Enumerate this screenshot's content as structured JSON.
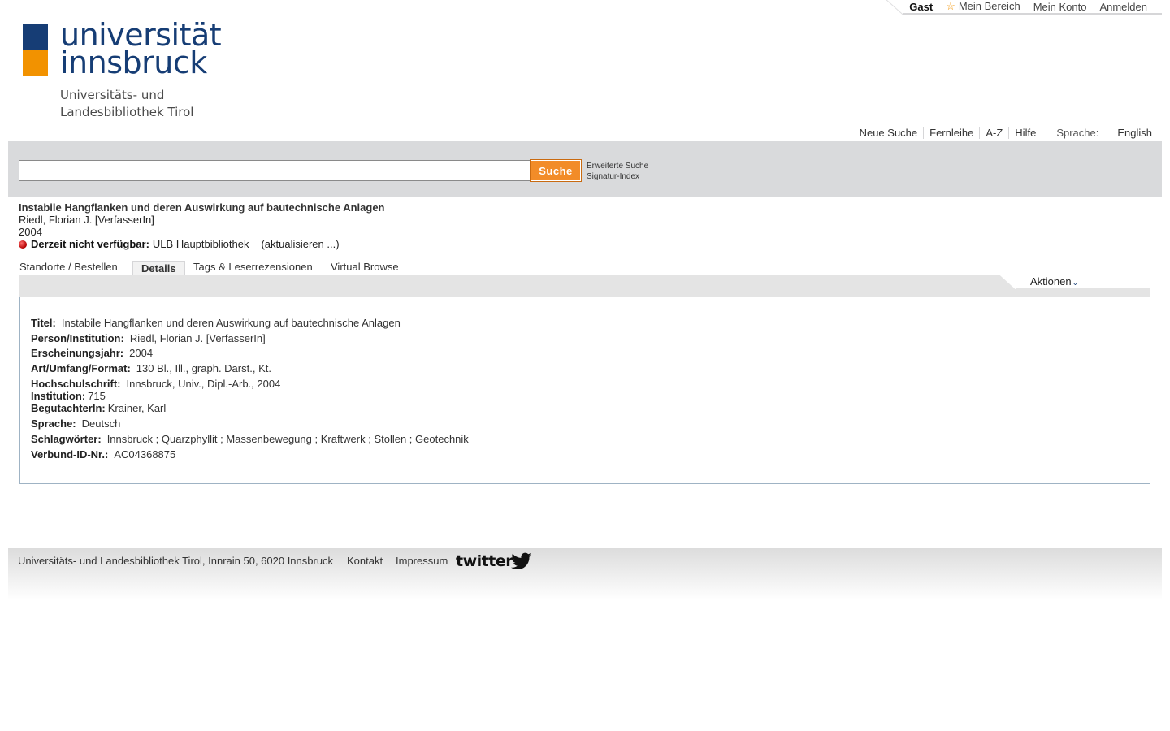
{
  "userbar": {
    "guest": "Gast",
    "my_area": "Mein Bereich",
    "my_account": "Mein Konto",
    "login": "Anmelden"
  },
  "logo": {
    "line1": "universität",
    "line2": "innsbruck",
    "sub1": "Universitäts- und",
    "sub2": "Landesbibliothek Tirol"
  },
  "topnav": {
    "items": [
      "Neue Suche",
      "Fernleihe",
      "A-Z",
      "Hilfe"
    ],
    "language_label": "Sprache:",
    "language": "English"
  },
  "search": {
    "value": "",
    "button": "Suche",
    "advanced": "Erweiterte Suche",
    "signature_index": "Signatur-Index"
  },
  "record": {
    "title": "Instabile Hangflanken und deren Auswirkung auf bautechnische Anlagen",
    "author": "Riedl, Florian J. [VerfasserIn]",
    "year": "2004",
    "availability_label": "Derzeit nicht verfügbar:",
    "availability_location": "ULB Hauptbibliothek",
    "refresh": "(aktualisieren ...)"
  },
  "tabs": [
    "Standorte / Bestellen",
    "Details",
    "Tags & Leserrezensionen",
    "Virtual Browse"
  ],
  "actions_label": "Aktionen",
  "details": [
    {
      "key": "Titel:",
      "value": "Instabile Hangflanken und deren Auswirkung auf bautechnische Anlagen"
    },
    {
      "key": "Person/Institution:",
      "value": "Riedl, Florian J. [VerfasserIn]"
    },
    {
      "key": "Erscheinungsjahr:",
      "value": "2004"
    },
    {
      "key": "Art/Umfang/Format:",
      "value": "130 Bl., Ill., graph. Darst., Kt."
    },
    {
      "key": "Hochschulschrift:",
      "value": "Innsbruck, Univ., Dipl.-Arb., 2004"
    },
    {
      "key": "Institution:",
      "value": "715"
    },
    {
      "key": "BegutachterIn:",
      "value": "Krainer, Karl"
    },
    {
      "key": "Sprache:",
      "value": "Deutsch"
    },
    {
      "key": "Schlagwörter:",
      "value": "Innsbruck ; Quarzphyllit ; Massenbewegung ; Kraftwerk ; Stollen ; Geotechnik"
    },
    {
      "key": "Verbund-ID-Nr.:",
      "value": "AC04368875"
    }
  ],
  "footer": {
    "address": "Universitäts- und Landesbibliothek Tirol, Innrain 50, 6020 Innsbruck",
    "contact": "Kontakt",
    "imprint": "Impressum",
    "twitter": "twitter"
  }
}
